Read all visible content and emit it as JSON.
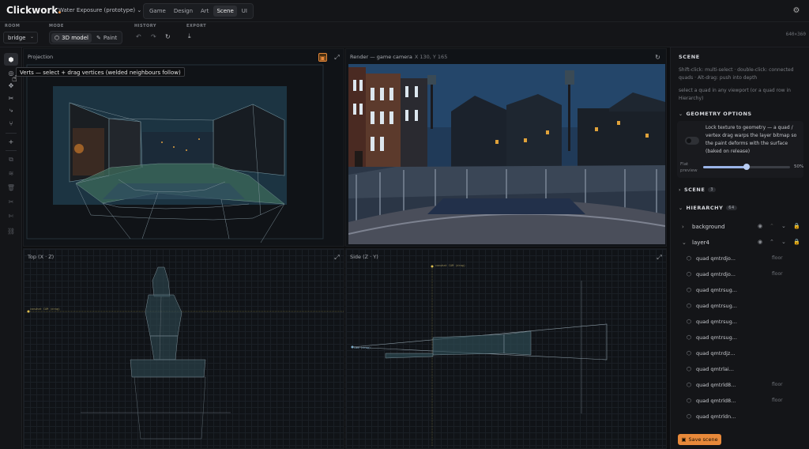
{
  "app": {
    "name": "Clickwork",
    "project": "Water Exposure (prototype)"
  },
  "nav_tabs": [
    {
      "label": "Game",
      "active": false
    },
    {
      "label": "Design",
      "active": false
    },
    {
      "label": "Art",
      "active": false
    },
    {
      "label": "Scene",
      "active": true
    },
    {
      "label": "UI",
      "active": false
    }
  ],
  "toolbar": {
    "room_label": "ROOM",
    "room_value": "bridge",
    "mode_label": "MODE",
    "mode_3d": "3D model",
    "mode_paint": "Paint",
    "history_label": "HISTORY",
    "export_label": "EXPORT",
    "resolution": "640×360"
  },
  "tooltip": "Verts — select + drag vertices (welded neighbours follow)",
  "viewports": {
    "projection": {
      "title": "Projection"
    },
    "render": {
      "title": "Render — game camera",
      "coords": "X 130, Y 165"
    },
    "top": {
      "title": "Top (X · Z)",
      "label": "conwhat CAM (drag)"
    },
    "side": {
      "title": "Side (Z · Y)",
      "label_a": "conwhat CAM (drag)",
      "label_b": "cam (drag)"
    }
  },
  "panel": {
    "title": "SCENE",
    "hint1": "Shift-click: multi-select · double-click: connected quads · Alt-drag: push into depth",
    "hint2": "select a quad in any viewport (or a quad row in Hierarchy)",
    "geometry_title": "GEOMETRY OPTIONS",
    "geometry_text": "Lock texture to geometry — a quad / vertex drag warps the layer bitmap so the paint deforms with the surface (baked on release)",
    "flat_label": "Flat preview",
    "flat_value": 0.5,
    "flat_value_text": "50%",
    "scene_title": "SCENE",
    "scene_count": "3",
    "hierarchy_title": "HIERARCHY",
    "hierarchy_count": "64",
    "layers": [
      {
        "name": "background",
        "expanded": false
      },
      {
        "name": "layer4",
        "expanded": true
      }
    ],
    "quads": [
      {
        "name": "quad qmtrdjo...",
        "tag": "floor"
      },
      {
        "name": "quad qmtrdjo...",
        "tag": "floor"
      },
      {
        "name": "quad qmtrsug...",
        "tag": ""
      },
      {
        "name": "quad qmtrsug...",
        "tag": ""
      },
      {
        "name": "quad qmtrsug...",
        "tag": ""
      },
      {
        "name": "quad qmtrsug...",
        "tag": ""
      },
      {
        "name": "quad qmtrdjz...",
        "tag": ""
      },
      {
        "name": "quad qmtrlai...",
        "tag": ""
      },
      {
        "name": "quad qmtrld8...",
        "tag": "floor"
      },
      {
        "name": "quad qmtrld8...",
        "tag": "floor"
      },
      {
        "name": "quad qmtrldn...",
        "tag": ""
      }
    ],
    "save_label": "Save scene"
  },
  "colors": {
    "accent": "#e8893a",
    "wire": "#6f8f9a",
    "fill_green": "#3d6a5a"
  }
}
